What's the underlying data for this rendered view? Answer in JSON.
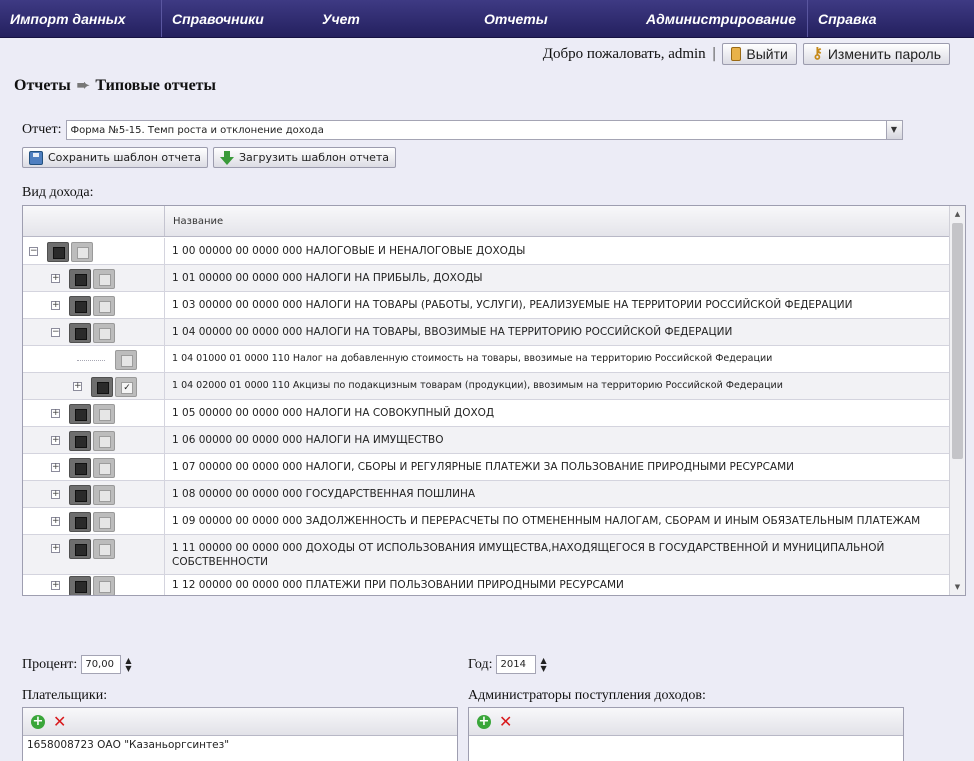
{
  "menu": {
    "items": [
      {
        "label": "Импорт данных"
      },
      {
        "label": "Справочники"
      },
      {
        "label": "Учет"
      },
      {
        "label": "Отчеты"
      },
      {
        "label": "Администрирование"
      },
      {
        "label": "Справка"
      }
    ]
  },
  "header": {
    "welcome": "Добро пожаловать, admin",
    "separator": "|",
    "logout_label": "Выйти",
    "change_password_label": "Изменить пароль"
  },
  "breadcrumb": {
    "part1": "Отчеты",
    "arrow": "➨",
    "part2": "Типовые отчеты"
  },
  "report": {
    "label": "Отчет:",
    "selected": "Форма №5-15. Темп роста и отклонение дохода",
    "dropdown_icon": "▼",
    "save_template_label": "Сохранить шаблон отчета",
    "load_template_label": "Загрузить шаблон отчета"
  },
  "income": {
    "label": "Вид дохода:",
    "column_name": "Название",
    "rows": [
      {
        "text": "1 00 00000 00 0000 000 НАЛОГОВЫЕ И НЕНАЛОГОВЫЕ ДОХОДЫ",
        "level": 0,
        "expander": "−",
        "checked": false
      },
      {
        "text": "1 01 00000 00 0000 000 НАЛОГИ НА ПРИБЫЛЬ, ДОХОДЫ",
        "level": 1,
        "expander": "+",
        "checked": false
      },
      {
        "text": "1 03 00000 00 0000 000 НАЛОГИ НА ТОВАРЫ (РАБОТЫ, УСЛУГИ), РЕАЛИЗУЕМЫЕ НА ТЕРРИТОРИИ РОССИЙСКОЙ ФЕДЕРАЦИИ",
        "level": 1,
        "expander": "+",
        "checked": false
      },
      {
        "text": "1 04 00000 00 0000 000 НАЛОГИ НА ТОВАРЫ, ВВОЗИМЫЕ НА ТЕРРИТОРИЮ РОССИЙСКОЙ ФЕДЕРАЦИИ",
        "level": 1,
        "expander": "−",
        "checked": false
      },
      {
        "text": "1 04 01000 01 0000 110 Налог на добавленную стоимость на товары, ввозимые на территорию Российской Федерации",
        "level": 2,
        "expander": "",
        "checked": false
      },
      {
        "text": "1 04 02000 01 0000 110 Акцизы по подакцизным товарам (продукции), ввозимым на территорию Российской Федерации",
        "level": 2,
        "expander": "+",
        "checked": true
      },
      {
        "text": "1 05 00000 00 0000 000 НАЛОГИ НА СОВОКУПНЫЙ ДОХОД",
        "level": 1,
        "expander": "+",
        "checked": false
      },
      {
        "text": "1 06 00000 00 0000 000 НАЛОГИ НА ИМУЩЕСТВО",
        "level": 1,
        "expander": "+",
        "checked": false
      },
      {
        "text": "1 07 00000 00 0000 000 НАЛОГИ, СБОРЫ И РЕГУЛЯРНЫЕ ПЛАТЕЖИ ЗА ПОЛЬЗОВАНИЕ ПРИРОДНЫМИ РЕСУРСАМИ",
        "level": 1,
        "expander": "+",
        "checked": false
      },
      {
        "text": "1 08 00000 00 0000 000 ГОСУДАРСТВЕННАЯ ПОШЛИНА",
        "level": 1,
        "expander": "+",
        "checked": false
      },
      {
        "text": "1 09 00000 00 0000 000 ЗАДОЛЖЕННОСТЬ И ПЕРЕРАСЧЕТЫ ПО ОТМЕНЕННЫМ НАЛОГАМ, СБОРАМ И ИНЫМ ОБЯЗАТЕЛЬНЫМ ПЛАТЕЖАМ",
        "level": 1,
        "expander": "+",
        "checked": false
      },
      {
        "text": "1 11 00000 00 0000 000 ДОХОДЫ ОТ ИСПОЛЬЗОВАНИЯ ИМУЩЕСТВА,НАХОДЯЩЕГОСЯ В ГОСУДАРСТВЕННОЙ И МУНИЦИПАЛЬНОЙ СОБСТВЕННОСТИ",
        "level": 1,
        "expander": "+",
        "checked": false
      },
      {
        "text": "1 12 00000 00 0000 000 ПЛАТЕЖИ ПРИ ПОЛЬЗОВАНИИ ПРИРОДНЫМИ РЕСУРСАМИ",
        "level": 1,
        "expander": "+",
        "checked": false
      }
    ]
  },
  "percent": {
    "label": "Процент:",
    "value": "70,00"
  },
  "year": {
    "label": "Год:",
    "value": "2014"
  },
  "payers": {
    "label": "Плательщики:",
    "items": [
      "1658008723 ОАО \"Казаньоргсинтез\""
    ]
  },
  "admins": {
    "label": "Администраторы поступления доходов:",
    "items": []
  }
}
